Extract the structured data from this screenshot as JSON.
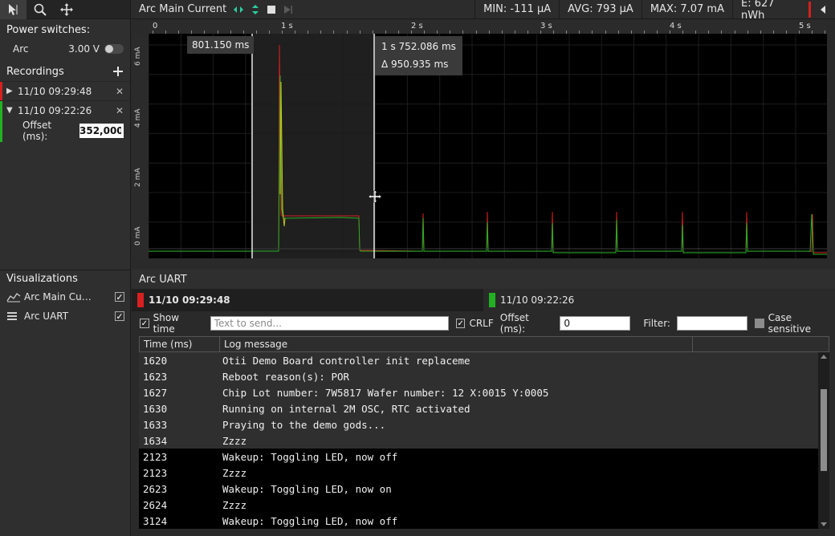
{
  "sidebar": {
    "power_switches_label": "Power switches:",
    "power": {
      "label": "Arc",
      "value": "3.00 V"
    },
    "recordings_label": "Recordings",
    "recordings": [
      {
        "label": "11/10 09:29:48",
        "color": "#d62020",
        "expanded": false
      },
      {
        "label": "11/10 09:22:26",
        "color": "#22b022",
        "expanded": true
      }
    ],
    "offset_label": "Offset (ms):",
    "offset_value": "352,000",
    "visualizations_label": "Visualizations",
    "visualizations": [
      {
        "label": "Arc Main Current",
        "icon": "line-chart-icon",
        "checked": true
      },
      {
        "label": "Arc UART",
        "icon": "list-icon",
        "checked": true
      }
    ]
  },
  "topbar": {
    "title": "Arc Main Current",
    "min": "MIN: -111 µA",
    "avg": "AVG: 793 µA",
    "max": "MAX: 7.07 mA",
    "energy": "E: 627 nWh"
  },
  "chart": {
    "time_ticks": [
      "0",
      "1 s",
      "2 s",
      "3 s",
      "4 s",
      "5 s"
    ],
    "y_ticks": [
      "0 mA",
      "2 mA",
      "4 mA",
      "6 mA"
    ],
    "cursor1": "801.150 ms",
    "cursor2": "1 s 752.086 ms",
    "delta": "Δ 950.935 ms",
    "colors": {
      "rec1": "#d62020",
      "rec2": "#22b022",
      "rec2_alt": "#c8c820"
    }
  },
  "uart": {
    "title": "Arc UART",
    "tab1": "11/10 09:29:48",
    "tab2": "11/10 09:22:26",
    "show_time_label": "Show time",
    "send_placeholder": "Text to send...",
    "crlf_label": "CRLF",
    "offset_label": "Offset (ms):",
    "offset_value": "0",
    "filter_label": "Filter:",
    "case_label": "Case sensitive",
    "col_time": "Time (ms)",
    "col_msg": "Log message",
    "rows": [
      {
        "time": "1620",
        "msg": "Otii Demo Board controller init replaceme"
      },
      {
        "time": "1623",
        "msg": "Reboot reason(s): POR"
      },
      {
        "time": "1627",
        "msg": "Chip Lot number: 7W5817 Wafer number: 12 X:0015 Y:0005"
      },
      {
        "time": "1630",
        "msg": "Running on internal 2M OSC, RTC activated"
      },
      {
        "time": "1633",
        "msg": "Praying to the demo gods..."
      },
      {
        "time": "1634",
        "msg": "Zzzz"
      },
      {
        "time": "2123",
        "msg": "Wakeup: Toggling LED, now off"
      },
      {
        "time": "2123",
        "msg": "Zzzz"
      },
      {
        "time": "2623",
        "msg": "Wakeup: Toggling LED, now on"
      },
      {
        "time": "2624",
        "msg": "Zzzz"
      },
      {
        "time": "3124",
        "msg": "Wakeup: Toggling LED, now off"
      }
    ]
  }
}
